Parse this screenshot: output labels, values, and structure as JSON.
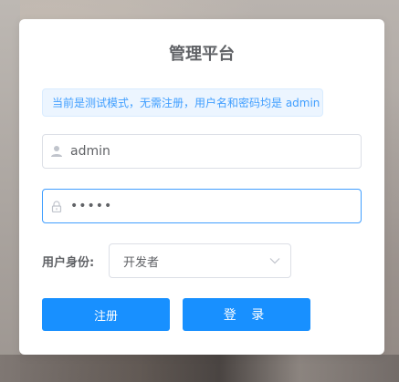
{
  "app": {
    "title": "管理平台"
  },
  "notice": {
    "text": "当前是测试模式，无需注册，用户名和密码均是 admin"
  },
  "form": {
    "username": {
      "value": "admin",
      "icon": "user-icon"
    },
    "password": {
      "masked_value": "•••••",
      "icon": "lock-icon"
    },
    "role": {
      "label": "用户身份:",
      "selected": "开发者",
      "icon": "chevron-down-icon"
    }
  },
  "buttons": {
    "register": "注册",
    "login": "登 录"
  },
  "colors": {
    "primary": "#1890ff",
    "alert_bg": "#ecf5ff",
    "alert_text": "#409eff",
    "focus_border": "#409eff"
  }
}
